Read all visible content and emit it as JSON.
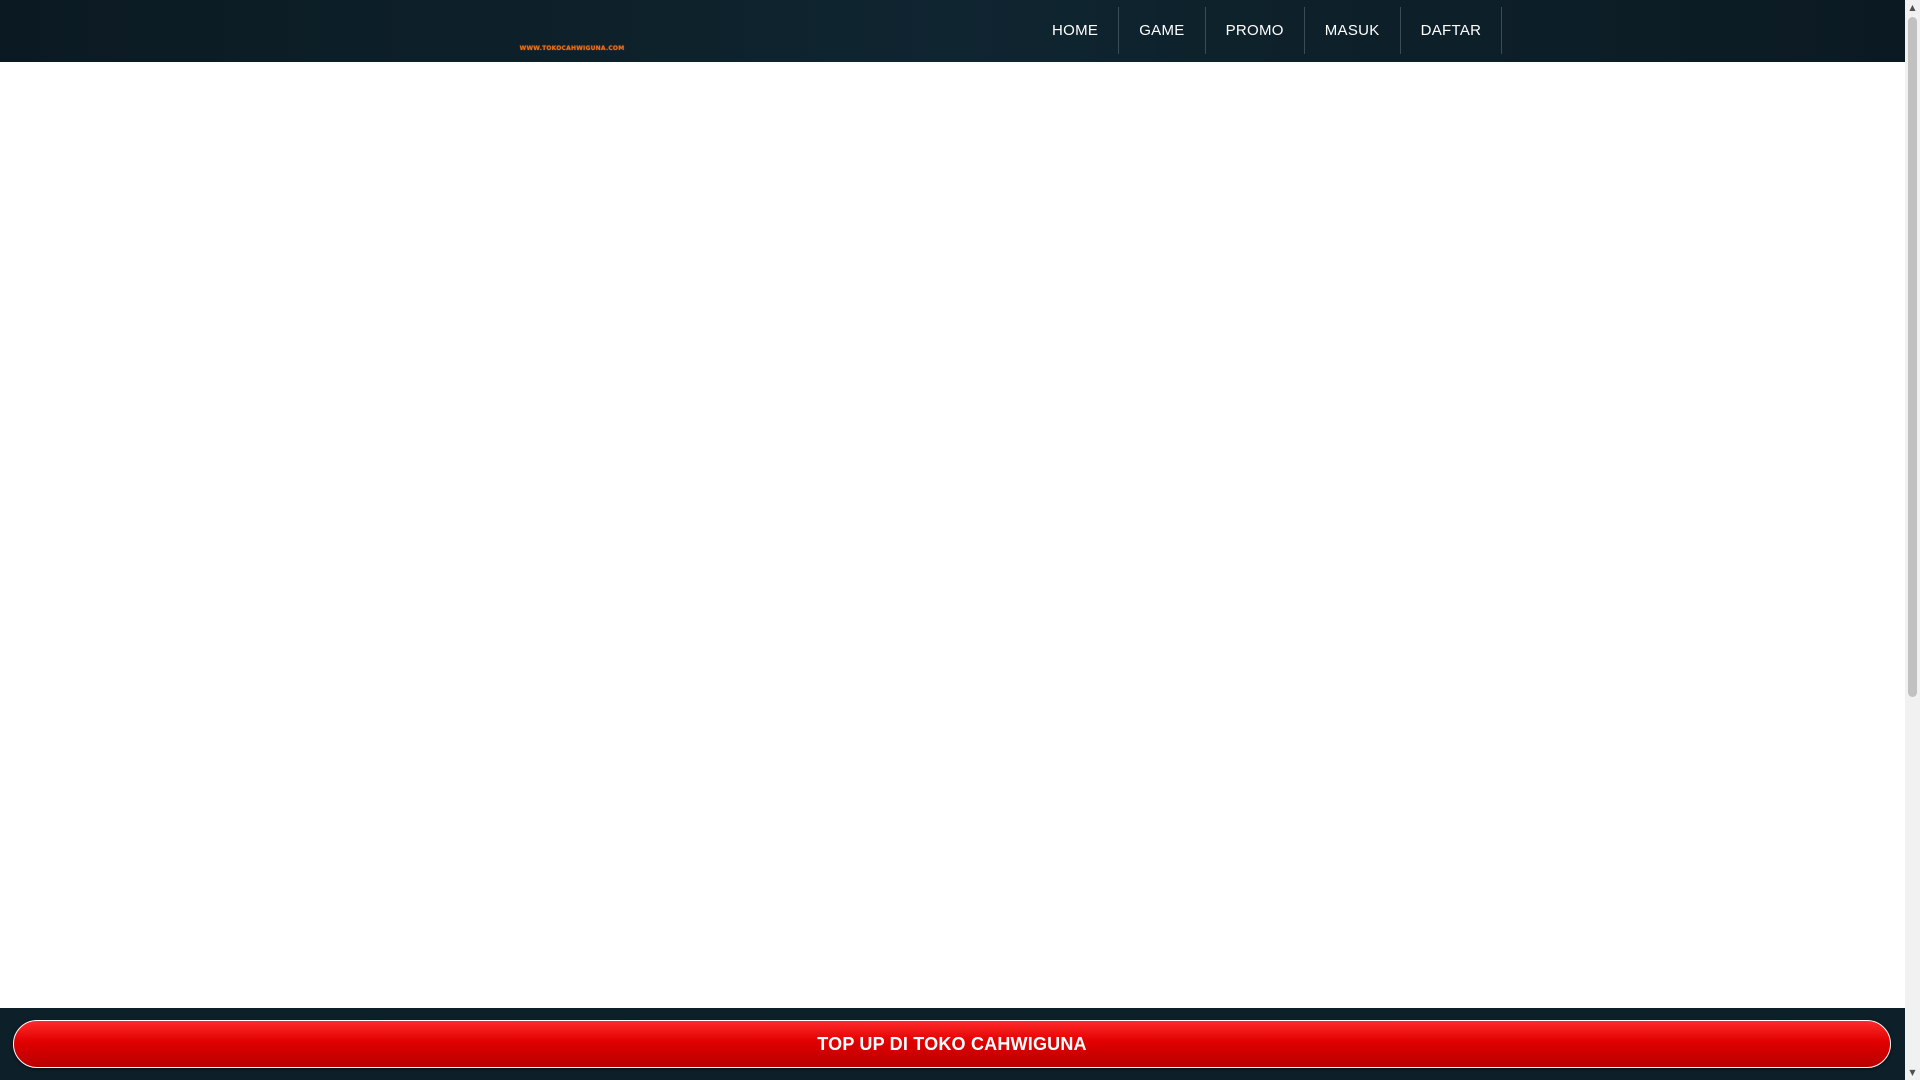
{
  "header": {
    "logo_text": "WWW.TOKOCAHWIGUNA.COM",
    "nav": [
      {
        "label": "HOME"
      },
      {
        "label": "GAME"
      },
      {
        "label": "PROMO"
      },
      {
        "label": "MASUK"
      },
      {
        "label": "DAFTAR"
      }
    ]
  },
  "footer": {
    "cta_label": "TOP UP DI TOKO CAHWIGUNA"
  },
  "scrollbar": {
    "up_icon": "▲",
    "down_icon": "▼"
  },
  "colors": {
    "header_bg": "#0f2530",
    "cta_red": "#e00000",
    "logo_orange": "#e0731c"
  }
}
